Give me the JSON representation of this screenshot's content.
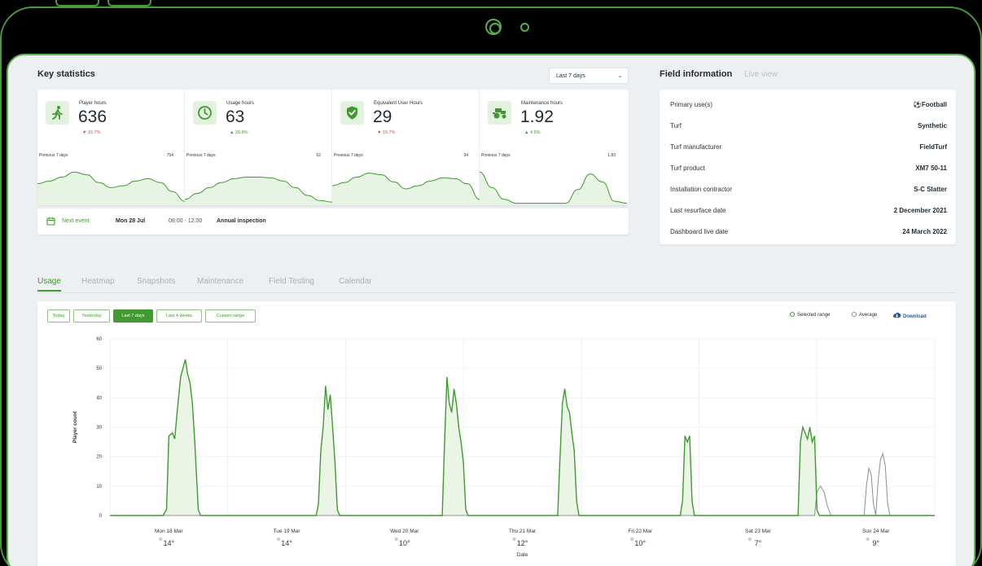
{
  "key_stats": {
    "title": "Key statistics",
    "range": "Last 7 days",
    "stats": [
      {
        "label": "Player hours",
        "value": "636",
        "delta": "▼ 15.7%",
        "trend": "down",
        "prev_label": "Previous 7 days",
        "prev_value": "754",
        "icon": "running-person-icon"
      },
      {
        "label": "Usage hours",
        "value": "63",
        "delta": "▲ 20.8%",
        "trend": "up",
        "prev_label": "Previous 7 days",
        "prev_value": "52",
        "icon": "clock-icon"
      },
      {
        "label": "Equivalent User Hours",
        "value": "29",
        "delta": "▼ 15.7%",
        "trend": "down",
        "prev_label": "Previous 7 days",
        "prev_value": "34",
        "icon": "shield-check-icon"
      },
      {
        "label": "Maintenance hours",
        "value": "1.92",
        "delta": "▲ 4.5%",
        "trend": "up",
        "prev_label": "Previous 7 days",
        "prev_value": "1.83",
        "icon": "tractor-icon"
      }
    ],
    "next_event": {
      "label": "Next event",
      "date": "Mon 28 Jul",
      "time": "08:00 - 12:00",
      "name": "Annual inspection"
    }
  },
  "field_info": {
    "title": "Field information",
    "live_view": "Live view",
    "rows": [
      {
        "key": "Primary use(s)",
        "value": "⚽Football"
      },
      {
        "key": "Turf",
        "value": "Synthetic"
      },
      {
        "key": "Turf manufacturer",
        "value": "FieldTurf"
      },
      {
        "key": "Turf product",
        "value": "XM7 50-11"
      },
      {
        "key": "Installation contractor",
        "value": "S-C Slatter"
      },
      {
        "key": "Last resurface date",
        "value": "2 December 2021"
      },
      {
        "key": "Dashboard live date",
        "value": "24 March 2022"
      }
    ]
  },
  "tabs": [
    "Usage",
    "Heatmap",
    "Snapshots",
    "Maintenance",
    "Field Testing",
    "Calendar"
  ],
  "active_tab": "Usage",
  "usage_panel": {
    "range_buttons": [
      "Today",
      "Yesterday",
      "Last 7 days",
      "Last 4 weeks",
      "Custom range"
    ],
    "active_range": "Last 7 days",
    "legend": {
      "selected": "Selected range",
      "average": "Average",
      "download": "Download"
    }
  },
  "colors": {
    "accent": "#3f9a2f",
    "avg_line": "#8a8f98",
    "down": "#d04848",
    "link": "#2c5aa0"
  },
  "chart_data": {
    "type": "line",
    "xlabel": "Date",
    "ylabel": "Player count",
    "ylim": [
      0,
      60
    ],
    "yticks": [
      0,
      10,
      20,
      30,
      40,
      50,
      60
    ],
    "grid": true,
    "days": [
      {
        "date": "Mon 18 Mar",
        "temp": "14°"
      },
      {
        "date": "Tue 19 Mar",
        "temp": "14°"
      },
      {
        "date": "Wed 20 Mar",
        "temp": "10°"
      },
      {
        "date": "Thu 21 Mar",
        "temp": "12°"
      },
      {
        "date": "Fri 22 Mar",
        "temp": "10°"
      },
      {
        "date": "Sat 23 Mar",
        "temp": "7°"
      },
      {
        "date": "Sun 24 Mar",
        "temp": "9°"
      }
    ],
    "series": [
      {
        "name": "Selected range",
        "points": [
          [
            0,
            0
          ],
          [
            0.45,
            0
          ],
          [
            0.48,
            2
          ],
          [
            0.5,
            27
          ],
          [
            0.53,
            28
          ],
          [
            0.55,
            26
          ],
          [
            0.57,
            35
          ],
          [
            0.6,
            47
          ],
          [
            0.62,
            50
          ],
          [
            0.64,
            53
          ],
          [
            0.66,
            48
          ],
          [
            0.68,
            45
          ],
          [
            0.7,
            38
          ],
          [
            0.72,
            25
          ],
          [
            0.75,
            2
          ],
          [
            0.77,
            0
          ],
          [
            1.75,
            0
          ],
          [
            1.77,
            4
          ],
          [
            1.79,
            22
          ],
          [
            1.81,
            30
          ],
          [
            1.83,
            44
          ],
          [
            1.85,
            36
          ],
          [
            1.87,
            41
          ],
          [
            1.89,
            30
          ],
          [
            1.91,
            18
          ],
          [
            1.93,
            2
          ],
          [
            1.95,
            0
          ],
          [
            2.82,
            0
          ],
          [
            2.84,
            25
          ],
          [
            2.86,
            47
          ],
          [
            2.88,
            38
          ],
          [
            2.9,
            35
          ],
          [
            2.92,
            43
          ],
          [
            2.94,
            38
          ],
          [
            2.96,
            30
          ],
          [
            2.98,
            25
          ],
          [
            3.0,
            18
          ],
          [
            3.02,
            2
          ],
          [
            3.04,
            0
          ],
          [
            3.8,
            0
          ],
          [
            3.82,
            20
          ],
          [
            3.84,
            38
          ],
          [
            3.86,
            43
          ],
          [
            3.88,
            37
          ],
          [
            3.9,
            35
          ],
          [
            3.92,
            28
          ],
          [
            3.94,
            22
          ],
          [
            3.96,
            5
          ],
          [
            3.98,
            0
          ],
          [
            4.84,
            0
          ],
          [
            4.86,
            5
          ],
          [
            4.88,
            27
          ],
          [
            4.9,
            25
          ],
          [
            4.92,
            27
          ],
          [
            4.94,
            5
          ],
          [
            4.96,
            0
          ],
          [
            5.84,
            0
          ],
          [
            5.86,
            25
          ],
          [
            5.88,
            30
          ],
          [
            5.9,
            28
          ],
          [
            5.92,
            26
          ],
          [
            5.94,
            30
          ],
          [
            5.96,
            25
          ],
          [
            5.98,
            27
          ],
          [
            6.0,
            2
          ],
          [
            6.02,
            0
          ],
          [
            7.0,
            0
          ]
        ]
      },
      {
        "name": "Average",
        "points": [
          [
            0,
            0
          ],
          [
            5.98,
            0
          ],
          [
            6.0,
            8
          ],
          [
            6.03,
            10
          ],
          [
            6.06,
            8
          ],
          [
            6.09,
            3
          ],
          [
            6.12,
            0
          ],
          [
            6.4,
            0
          ],
          [
            6.42,
            10
          ],
          [
            6.44,
            16
          ],
          [
            6.46,
            14
          ],
          [
            6.48,
            4
          ],
          [
            6.5,
            0
          ],
          [
            6.52,
            12
          ],
          [
            6.54,
            19
          ],
          [
            6.56,
            21
          ],
          [
            6.58,
            17
          ],
          [
            6.6,
            4
          ],
          [
            6.62,
            0
          ],
          [
            7.0,
            0
          ]
        ]
      }
    ]
  },
  "sparklines": [
    [
      0.55,
      0.62,
      0.72,
      0.85,
      0.78,
      0.58,
      0.45,
      0.5,
      0.62,
      0.68,
      0.58,
      0.35,
      0.1
    ],
    [
      0.15,
      0.3,
      0.45,
      0.58,
      0.68,
      0.72,
      0.72,
      0.7,
      0.62,
      0.45,
      0.25,
      0.12,
      0.08
    ],
    [
      0.5,
      0.58,
      0.72,
      0.82,
      0.78,
      0.6,
      0.42,
      0.5,
      0.62,
      0.7,
      0.68,
      0.55,
      0.15
    ],
    [
      0.85,
      0.45,
      0.15,
      0.05,
      0.05,
      0.05,
      0.05,
      0.05,
      0.4,
      0.8,
      0.6,
      0.1,
      0.05
    ]
  ]
}
